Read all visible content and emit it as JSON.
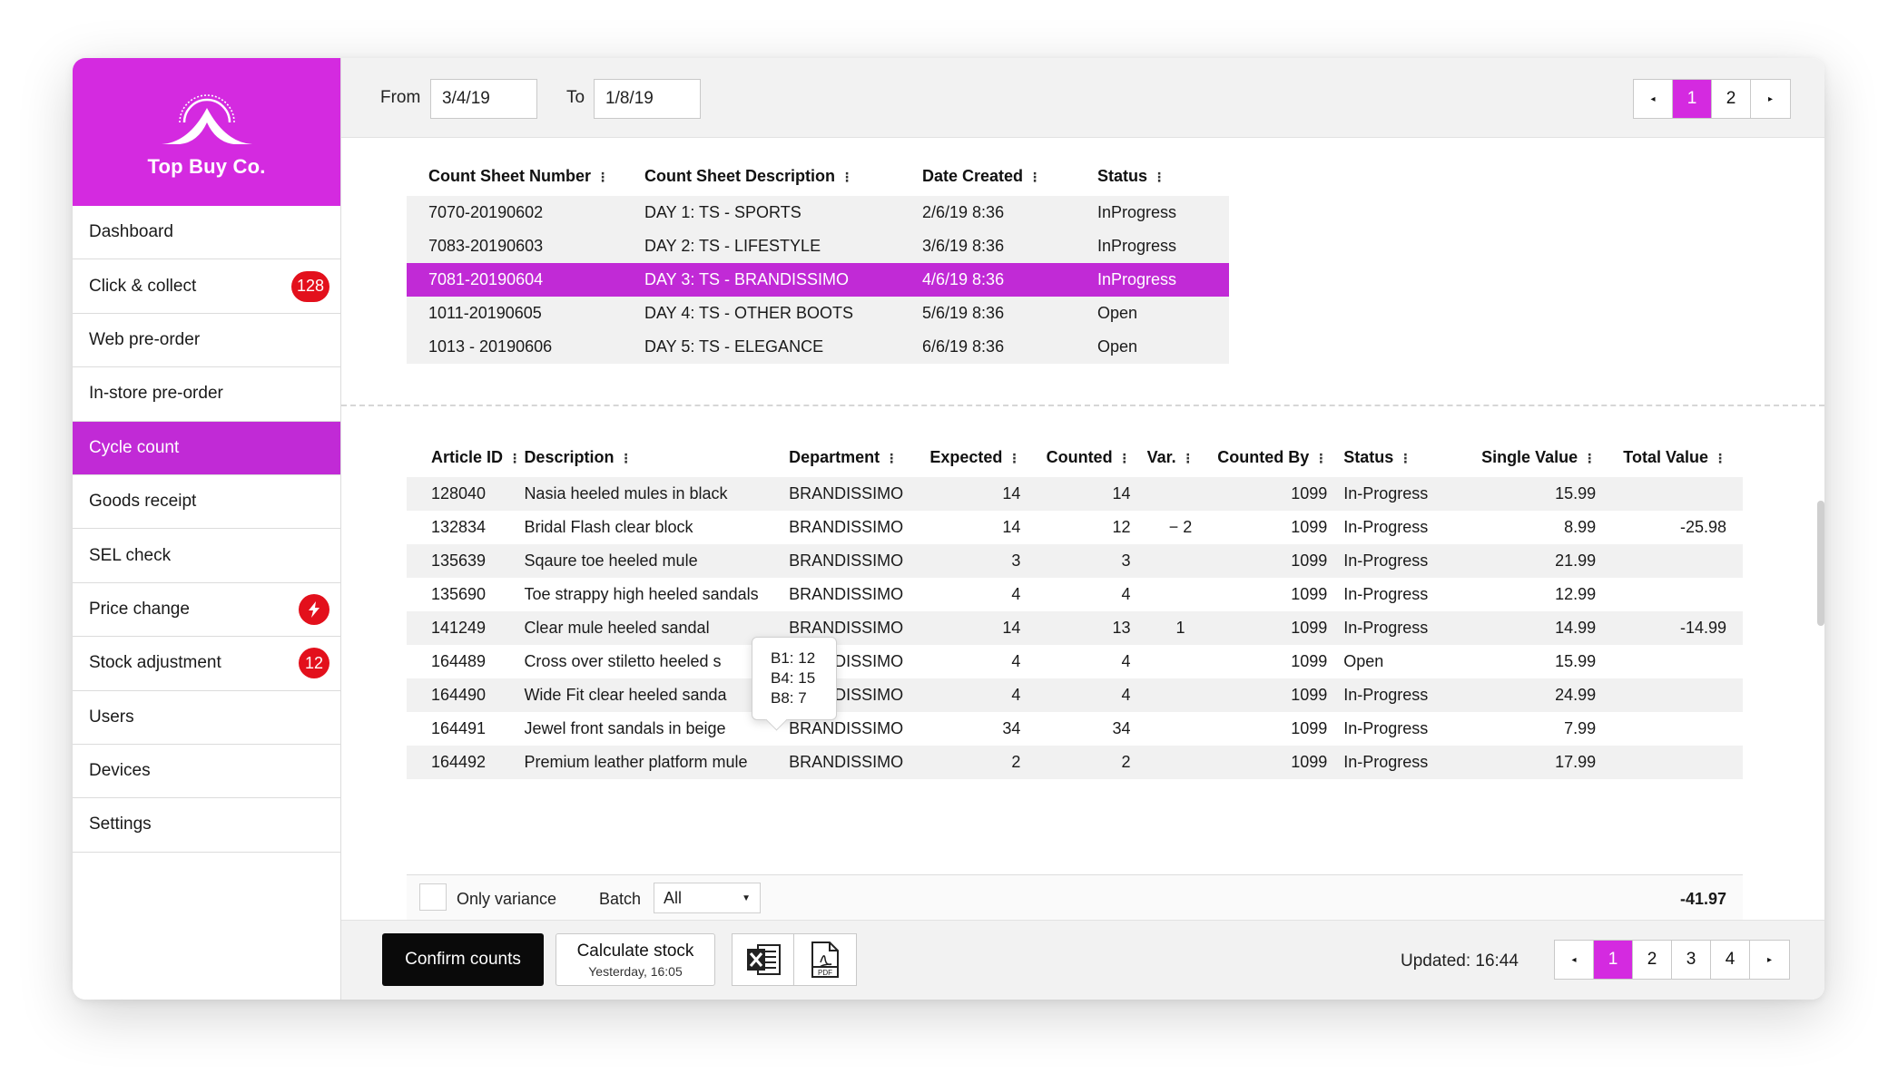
{
  "brand": {
    "name": "Top Buy Co.",
    "color": "#d42ae0"
  },
  "sidebar": {
    "items": [
      {
        "label": "Dashboard"
      },
      {
        "label": "Click & collect",
        "badge": "128"
      },
      {
        "label": "Web pre-order"
      },
      {
        "label": "In-store pre-order"
      },
      {
        "label": "Cycle count",
        "active": true
      },
      {
        "label": "Goods receipt"
      },
      {
        "label": "SEL check"
      },
      {
        "label": "Price change",
        "badge_icon": "lightning-icon"
      },
      {
        "label": "Stock adjustment",
        "badge": "12"
      },
      {
        "label": "Users"
      },
      {
        "label": "Devices"
      },
      {
        "label": "Settings"
      }
    ]
  },
  "filters": {
    "from_label": "From",
    "from_value": "3/4/19",
    "to_label": "To",
    "to_value": "1/8/19"
  },
  "top_pager": {
    "prev": "◂",
    "pages": [
      "1",
      "2"
    ],
    "next": "▸",
    "active": "1"
  },
  "count_sheets": {
    "headers": [
      "Count Sheet Number",
      "Count Sheet Description",
      "Date Created",
      "Status"
    ],
    "rows": [
      [
        "7070-20190602",
        "DAY 1: TS - SPORTS",
        "2/6/19 8:36",
        "InProgress"
      ],
      [
        "7083-20190603",
        "DAY 2: TS - LIFESTYLE",
        "3/6/19 8:36",
        "InProgress"
      ],
      [
        "7081-20190604",
        "DAY 3: TS - BRANDISSIMO",
        "4/6/19 8:36",
        "InProgress"
      ],
      [
        "1011-20190605",
        "DAY 4: TS - OTHER BOOTS",
        "5/6/19 8:36",
        "Open"
      ],
      [
        "1013 - 20190606",
        "DAY 5: TS - ELEGANCE",
        "6/6/19 8:36",
        "Open"
      ]
    ],
    "selected_index": 2
  },
  "articles": {
    "headers": [
      "Article ID",
      "Description",
      "Department",
      "Expected",
      "Counted",
      "Var.",
      "Counted By",
      "Status",
      "Single Value",
      "Total Value"
    ],
    "rows": [
      [
        "128040",
        "Nasia heeled mules in black",
        "BRANDISSIMO",
        "14",
        "14",
        "",
        "1099",
        "In-Progress",
        "15.99",
        ""
      ],
      [
        "132834",
        "Bridal Flash clear block",
        "BRANDISSIMO",
        "14",
        "12",
        "− 2",
        "1099",
        "In-Progress",
        "8.99",
        "-25.98"
      ],
      [
        "135639",
        "Sqaure toe heeled mule",
        "BRANDISSIMO",
        "3",
        "3",
        "",
        "1099",
        "In-Progress",
        "21.99",
        ""
      ],
      [
        "135690",
        "Toe strappy high heeled sandals",
        "BRANDISSIMO",
        "4",
        "4",
        "",
        "1099",
        "In-Progress",
        "12.99",
        ""
      ],
      [
        "141249",
        "Clear mule heeled sandal",
        "BRANDISSIMO",
        "14",
        "13",
        "1",
        "1099",
        "In-Progress",
        "14.99",
        "-14.99"
      ],
      [
        "164489",
        "Cross over stiletto heeled s",
        "BRANDISSIMO",
        "4",
        "4",
        "",
        "1099",
        "Open",
        "15.99",
        ""
      ],
      [
        "164490",
        "Wide Fit clear heeled sanda",
        "BRANDISSIMO",
        "4",
        "4",
        "",
        "1099",
        "In-Progress",
        "24.99",
        ""
      ],
      [
        "164491",
        "Jewel front sandals in beige",
        "BRANDISSIMO",
        "34",
        "34",
        "",
        "1099",
        "In-Progress",
        "7.99",
        ""
      ],
      [
        "164492",
        "Premium leather platform mule",
        "BRANDISSIMO",
        "2",
        "2",
        "",
        "1099",
        "In-Progress",
        "17.99",
        ""
      ]
    ]
  },
  "tooltip": {
    "lines": [
      "B1: 12",
      "B4: 15",
      "B8: 7"
    ]
  },
  "filter_bar": {
    "only_variance_label": "Only variance",
    "batch_label": "Batch",
    "batch_value": "All",
    "total": "-41.97"
  },
  "actions": {
    "confirm_label": "Confirm counts",
    "calculate_label": "Calculate stock",
    "calculate_sub": "Yesterday, 16:05",
    "updated": "Updated: 16:44"
  },
  "bottom_pager": {
    "prev": "◂",
    "pages": [
      "1",
      "2",
      "3",
      "4"
    ],
    "next": "▸",
    "active": "1"
  }
}
